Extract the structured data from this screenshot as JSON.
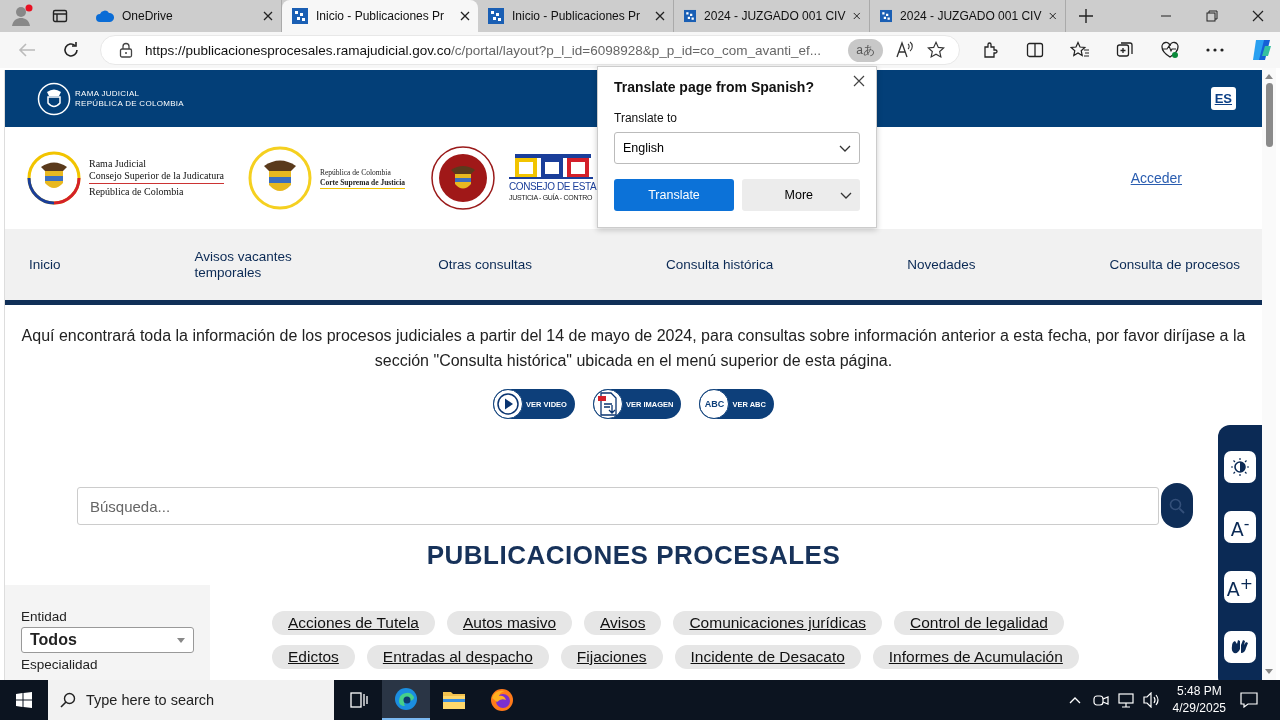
{
  "browser": {
    "tabs": [
      {
        "title": "OneDrive",
        "kind": "cloud",
        "selected": false
      },
      {
        "title": "Inicio - Publicaciones Pr",
        "kind": "site",
        "selected": true
      },
      {
        "title": "Inicio - Publicaciones Pr",
        "kind": "site",
        "selected": false
      },
      {
        "title": "2024 - JUZGADO 001 CIV",
        "kind": "site",
        "selected": false
      },
      {
        "title": "2024 - JUZGADO 001 CIV",
        "kind": "site",
        "selected": false
      }
    ],
    "url_host": "https://publicacionesprocesales.ramajudicial.gov.co",
    "url_path": "/c/portal/layout?p_l_id=6098928&p_p_id=co_com_avanti_ef...",
    "translate_badge": "aあ"
  },
  "header": {
    "brand": [
      "RAMA JUDICIAL",
      "REPÚBLICA DE COLOMBIA"
    ],
    "language": "ES"
  },
  "logos": [
    {
      "kind": "judicatura",
      "lines": [
        "Rama Judicial",
        "Consejo Superior de la Judicatura",
        "República de Colombia"
      ]
    },
    {
      "kind": "corte",
      "lines": [
        "República de Colombia",
        "Corte Suprema de Justicia"
      ]
    },
    {
      "kind": "seal"
    },
    {
      "kind": "consejo",
      "lines": [
        "CONSEJO DE ESTA",
        "JUSTICIA - GUÍA - CONTRO"
      ]
    }
  ],
  "login": "Acceder",
  "nav": [
    "Inicio",
    "Avisos vacantes temporales",
    "Otras consultas",
    "Consulta histórica",
    "Novedades",
    "Consulta de procesos"
  ],
  "intro": "Aquí encontrará toda la información de los procesos judiciales a partir del 14 de mayo de 2024, para consultas sobre información anterior a esta fecha, por favor diríjase a la sección \"Consulta histórica\" ubicada en el menú superior de esta página.",
  "media_buttons": [
    {
      "kind": "video",
      "label": "VER VIDEO"
    },
    {
      "kind": "pdf",
      "label": "VER IMAGEN"
    },
    {
      "kind": "abc",
      "badge": "ABC",
      "label": "VER ABC"
    }
  ],
  "search": {
    "placeholder": "Búsqueda..."
  },
  "title": "PUBLICACIONES PROCESALES",
  "filters": [
    {
      "label": "Entidad",
      "value": "Todos"
    },
    {
      "label": "Especialidad"
    }
  ],
  "category_rows": [
    [
      "Acciones de Tutela",
      "Autos masivo",
      "Avisos",
      "Comunicaciones jurídicas",
      "Control de legalidad"
    ],
    [
      "Edictos",
      "Entradas al despacho",
      "Fijaciones",
      "Incidente de Desacato",
      "Informes de Acumulación"
    ]
  ],
  "accessibility": [
    {
      "kind": "contrast"
    },
    {
      "kind": "text",
      "label": "A$^{-}$"
    },
    {
      "kind": "text",
      "label": "A$^{+}$"
    },
    {
      "kind": "sign"
    }
  ],
  "translate_popup": {
    "title": "Translate page from Spanish?",
    "label": "Translate to",
    "language": "English",
    "primary": "Translate",
    "secondary": "More"
  },
  "taskbar": {
    "search_placeholder": "Type here to search",
    "time": "5:48 PM",
    "date": "4/29/2025"
  }
}
